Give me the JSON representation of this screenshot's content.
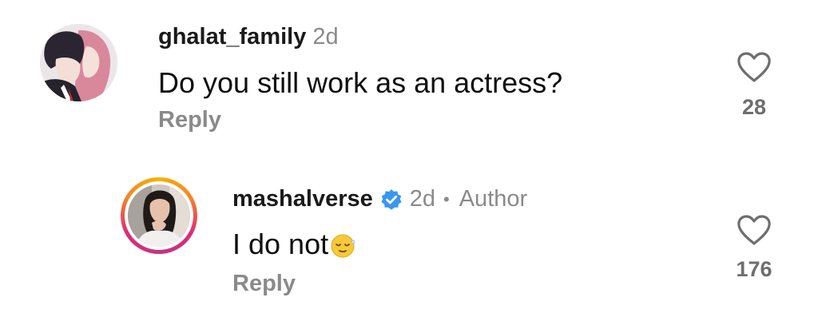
{
  "comments": [
    {
      "username": "ghalat_family",
      "time": "2d",
      "text": "Do you still work as an actress?",
      "reply_label": "Reply",
      "likes": "28",
      "avatar_icon": "anime-couple-avatar",
      "like_icon": "heart-outline-icon"
    },
    {
      "username": "mashalverse",
      "verified": true,
      "time": "2d",
      "separator": "•",
      "author_label": "Author",
      "text": "I do not",
      "emoji": "relieved-face-emoji",
      "reply_label": "Reply",
      "likes": "176",
      "avatar_icon": "profile-photo-avatar",
      "story_ring_colors": [
        "#f4b400",
        "#f58529",
        "#dd2a7b",
        "#c13584"
      ],
      "like_icon": "heart-outline-icon"
    }
  ],
  "colors": {
    "text_primary": "#0f0f0f",
    "text_secondary": "#8a8a8a",
    "verified_badge": "#3897f0",
    "background": "#ffffff"
  }
}
